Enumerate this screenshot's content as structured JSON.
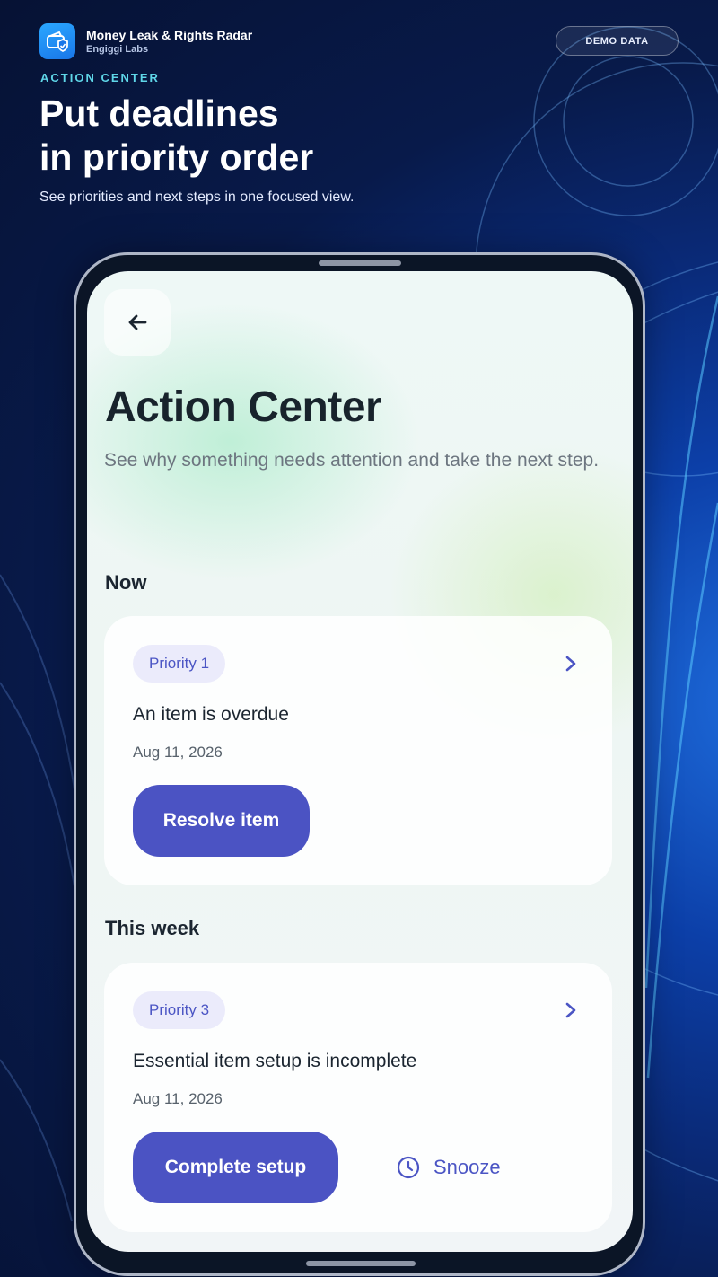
{
  "brand": {
    "name": "Money Leak & Rights Radar",
    "company": "Engiggi Labs",
    "logo_icon": "wallet-shield-icon",
    "logo_color": "#1f8af0"
  },
  "badge": "DEMO DATA",
  "hero": {
    "kicker": "ACTION CENTER",
    "headline_line1": "Put deadlines",
    "headline_line2": "in priority order",
    "subline": "See priorities and next steps in one focused view."
  },
  "screen": {
    "back_icon": "arrow-left-icon",
    "title": "Action Center",
    "description": "See why something needs attention and take the next step.",
    "sections": [
      {
        "label": "Now",
        "card": {
          "priority": "Priority 1",
          "title": "An item is overdue",
          "date": "Aug 11, 2026",
          "primary_action": "Resolve item"
        }
      },
      {
        "label": "This week",
        "card": {
          "priority": "Priority 3",
          "title": "Essential item setup is incomplete",
          "date": "Aug 11, 2026",
          "primary_action": "Complete setup",
          "secondary_action": "Snooze",
          "secondary_icon": "clock-icon"
        }
      }
    ]
  },
  "colors": {
    "accent": "#4b53c3",
    "kicker": "#5fd6e8",
    "background": "#0a2a78"
  }
}
